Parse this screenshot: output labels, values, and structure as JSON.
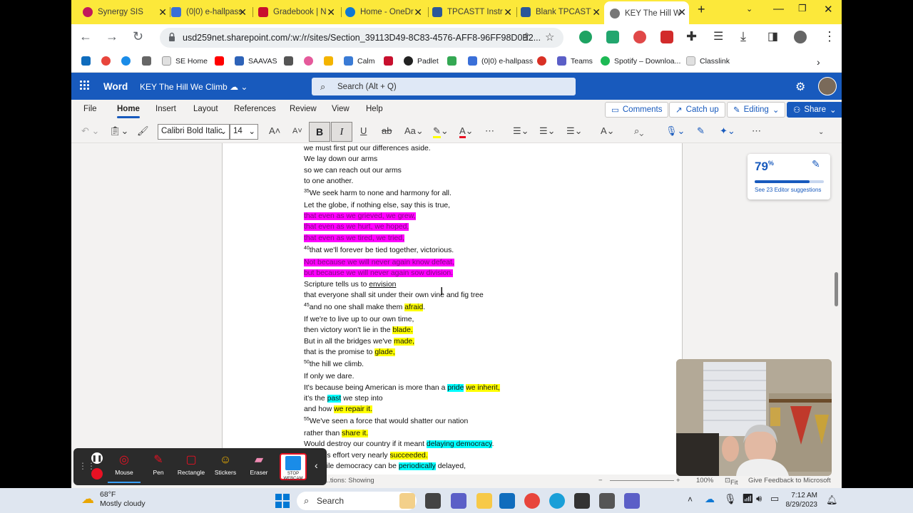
{
  "browser": {
    "tabs": [
      {
        "label": "Synergy SIS",
        "color": "#c2185b"
      },
      {
        "label": "(0|0) e-hallpass",
        "color": "#3a6fd8"
      },
      {
        "label": "Gradebook | N",
        "color": "#c8102e"
      },
      {
        "label": "Home - OneDr",
        "color": "#0f78d4"
      },
      {
        "label": "TPCASTT Instru",
        "color": "#2b579a"
      },
      {
        "label": "Blank TPCASTT",
        "color": "#2b579a"
      },
      {
        "label": "KEY The Hill W",
        "color": "#2b579a"
      }
    ],
    "new_tab": "+",
    "url": "usd259net.sharepoint.com/:w:/r/sites/Section_39113D49-8C83-4576-AFF8-96FF98D0B2...",
    "bookmarks": [
      "",
      "",
      "",
      "",
      "SE Home",
      "",
      "SAAVAS",
      "",
      "",
      "",
      "Calm",
      "",
      "Padlet",
      "",
      "(0|0) e-hallpass",
      "",
      "Teams",
      "Spotify – Downloa...",
      "Classlink"
    ]
  },
  "word": {
    "app_name": "Word",
    "doc_title": "KEY The Hill We Climb",
    "search_placeholder": "Search (Alt + Q)",
    "menu": [
      "File",
      "Home",
      "Insert",
      "Layout",
      "References",
      "Review",
      "View",
      "Help"
    ],
    "buttons": {
      "comments": "Comments",
      "catch_up": "Catch up",
      "editing": "Editing",
      "share": "Share"
    },
    "font_name": "Calibri Bold Italic",
    "font_size": "14",
    "editor": {
      "score": "79",
      "unit": "%",
      "suggestions": "See 23 Editor suggestions",
      "progress": 0.79
    },
    "status": {
      "left": "...tions: Showing",
      "zoom": "100%",
      "fit": "Fit",
      "feedback": "Give Feedback to Microsoft"
    }
  },
  "document": {
    "lines": [
      [
        {
          "t": "we must first put our differences aside."
        }
      ],
      [
        {
          "t": "We lay down our arms"
        }
      ],
      [
        {
          "t": "so we can reach out our arms"
        }
      ],
      [
        {
          "t": "to one another."
        }
      ],
      [
        {
          "sup": "35"
        },
        {
          "t": "We seek harm to none and harmony for all."
        }
      ],
      [
        {
          "t": "Let the globe, if nothing else, say this is true,"
        }
      ],
      [
        {
          "t": "that even as we grieved, we grew,",
          "h": "hm"
        }
      ],
      [
        {
          "t": "that even as we hurt, we hoped,",
          "h": "hm"
        }
      ],
      [
        {
          "t": "that even as we tired, we tried,",
          "h": "hm"
        }
      ],
      [
        {
          "sup": "40"
        },
        {
          "t": "that we'll forever be tied together, victorious."
        }
      ],
      [
        {
          "t": "Not because we will never again know defeat,",
          "h": "hm"
        }
      ],
      [
        {
          "t": "but because we will never again sow division.",
          "h": "hm"
        }
      ],
      [
        {
          "t": "Scripture tells us to "
        },
        {
          "t": "envision",
          "h": "u"
        }
      ],
      [
        {
          "t": "that everyone shall sit under their own vine and fig tree"
        }
      ],
      [
        {
          "sup": "45"
        },
        {
          "t": "and no one shall make them "
        },
        {
          "t": "afraid",
          "h": "hy"
        },
        {
          "t": "."
        }
      ],
      [
        {
          "t": "If we're to live up to our own time,"
        }
      ],
      [
        {
          "t": "then victory won't lie in the "
        },
        {
          "t": "blade.",
          "h": "hy"
        }
      ],
      [
        {
          "t": "But in all the bridges we've "
        },
        {
          "t": "made,",
          "h": "hy"
        }
      ],
      [
        {
          "t": "that is the promise to "
        },
        {
          "t": "glade,",
          "h": "hy"
        }
      ],
      [
        {
          "sup": "50"
        },
        {
          "t": "the hill we climb."
        }
      ],
      [
        {
          "t": "If only we dare."
        }
      ],
      [
        {
          "t": "It's because being American is more than a "
        },
        {
          "t": "pride",
          "h": "hc"
        },
        {
          "t": " "
        },
        {
          "t": "we inherit,",
          "h": "hy"
        }
      ],
      [
        {
          "t": "it's the "
        },
        {
          "t": "past",
          "h": "hc"
        },
        {
          "t": " we step into"
        }
      ],
      [
        {
          "t": "and how "
        },
        {
          "t": "we repair it.",
          "h": "hy"
        }
      ],
      [
        {
          "sup": "55"
        },
        {
          "t": "We've seen a force that would shatter our nation"
        }
      ],
      [
        {
          "t": "rather than "
        },
        {
          "t": "share it.",
          "h": "hy"
        }
      ],
      [
        {
          "t": "Would destroy our country if it meant "
        },
        {
          "t": "delaying democracy",
          "h": "hc"
        },
        {
          "t": "."
        }
      ],
      [
        {
          "t": "And this effort very nearly "
        },
        {
          "t": "succeeded.",
          "h": "hy"
        }
      ],
      [
        {
          "t": "But while democracy can be "
        },
        {
          "t": "periodically",
          "h": "hc"
        },
        {
          "t": " delayed,"
        }
      ]
    ]
  },
  "annotation_toolbar": [
    "Mouse",
    "Pen",
    "Rectangle",
    "Stickers",
    "Eraser",
    "STOP WEBCAM"
  ],
  "taskbar": {
    "temp": "68°F",
    "weather": "Mostly cloudy",
    "search": "Search",
    "time": "7:12 AM",
    "date": "8/29/2023"
  }
}
